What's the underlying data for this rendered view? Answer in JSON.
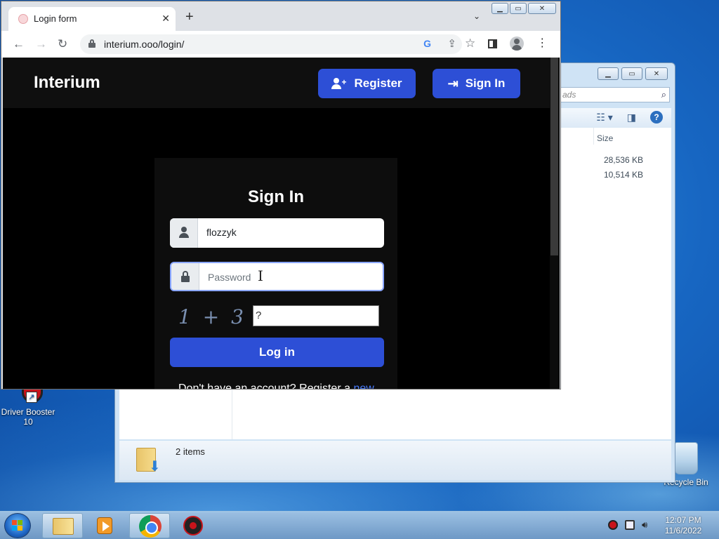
{
  "desktop": {
    "icons": [
      {
        "label": "Driver Booster 10"
      },
      {
        "label": "Recycle Bin"
      }
    ]
  },
  "explorer": {
    "search_placeholder": "ads",
    "column_size": "Size",
    "sizes": [
      "28,536 KB",
      "10,514 KB"
    ],
    "status_count": "2 items"
  },
  "browser": {
    "tab_title": "Login form",
    "url": "interium.ooo/login/",
    "new_tab_symbol": "+",
    "close_tab_symbol": "✕"
  },
  "site": {
    "brand": "Interium",
    "nav": {
      "register": "Register",
      "sign_in": "Sign In"
    },
    "form": {
      "title": "Sign In",
      "username_value": "flozzyk",
      "password_placeholder": "Password",
      "captcha_text": "1 + 3 =",
      "captcha_answer": "?",
      "submit": "Log in",
      "register_note": "Don't have an account? Register a",
      "register_link": "new"
    }
  },
  "taskbar": {
    "time": "12:07 PM",
    "date": "11/6/2022"
  },
  "colors": {
    "accent_blue": "#2d4fd6",
    "page_background": "#000000",
    "card_background": "#0d0d0d"
  }
}
